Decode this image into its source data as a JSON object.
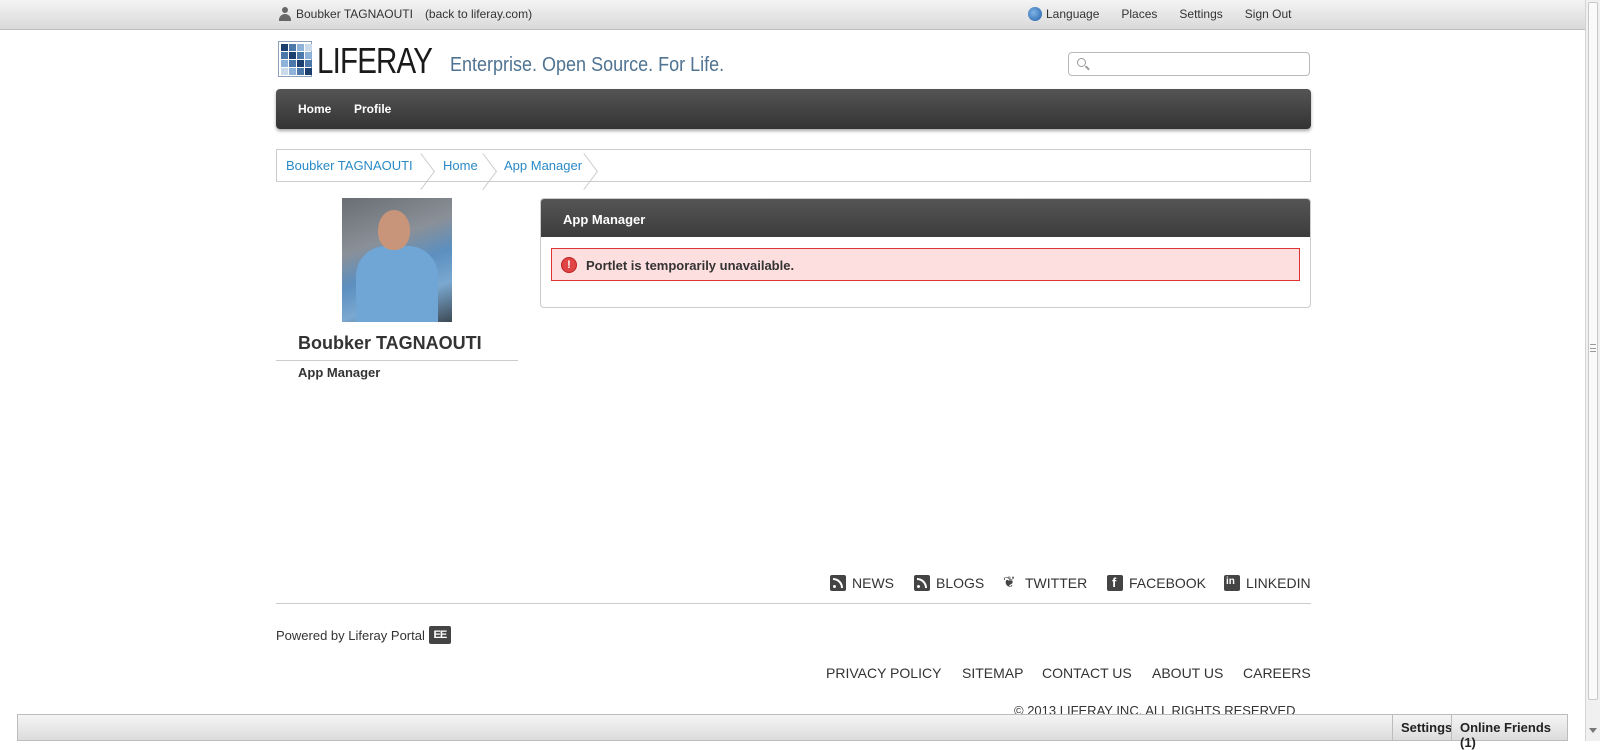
{
  "dockbar": {
    "user_name": "Boubker TAGNAOUTI",
    "back_link": "(back to liferay.com)",
    "language": "Language",
    "places": "Places",
    "settings": "Settings",
    "sign_out": "Sign Out"
  },
  "header": {
    "logo_text": "LIFERAY",
    "tagline": "Enterprise. Open Source. For Life.",
    "search_placeholder": "",
    "logo_colors": [
      "#1d3f6e",
      "#4b78a8",
      "#8fb3d8",
      "#c9daea"
    ]
  },
  "nav": {
    "items": [
      {
        "label": "Home"
      },
      {
        "label": "Profile"
      }
    ]
  },
  "breadcrumb": {
    "items": [
      {
        "label": "Boubker TAGNAOUTI"
      },
      {
        "label": "Home"
      },
      {
        "label": "App Manager"
      }
    ]
  },
  "profile": {
    "name": "Boubker TAGNAOUTI",
    "role": "App Manager"
  },
  "portlet": {
    "title": "App Manager",
    "alert_icon": "!",
    "alert_text": "Portlet is temporarily unavailable."
  },
  "footer": {
    "social": [
      {
        "label": "NEWS",
        "icon": "rss-icon"
      },
      {
        "label": "BLOGS",
        "icon": "rss-icon"
      },
      {
        "label": "TWITTER",
        "icon": "twitter-icon"
      },
      {
        "label": "FACEBOOK",
        "icon": "facebook-icon"
      },
      {
        "label": "LINKEDIN",
        "icon": "linkedin-icon"
      }
    ],
    "powered_by": "Powered by Liferay Portal",
    "ee_badge": "EE",
    "links": [
      {
        "label": "PRIVACY POLICY"
      },
      {
        "label": "SITEMAP"
      },
      {
        "label": "CONTACT US"
      },
      {
        "label": "ABOUT US"
      },
      {
        "label": "CAREERS"
      }
    ],
    "copyright": "© 2013 LIFERAY INC. ALL RIGHTS RESERVED"
  },
  "bottom_dock": {
    "settings": "Settings",
    "online_friends": "Online Friends (1)"
  },
  "colors": {
    "link": "#2a8ac6",
    "nav_bg": "#3c3c3c",
    "alert_bg": "#fedfe0",
    "alert_border": "#dd3333"
  }
}
